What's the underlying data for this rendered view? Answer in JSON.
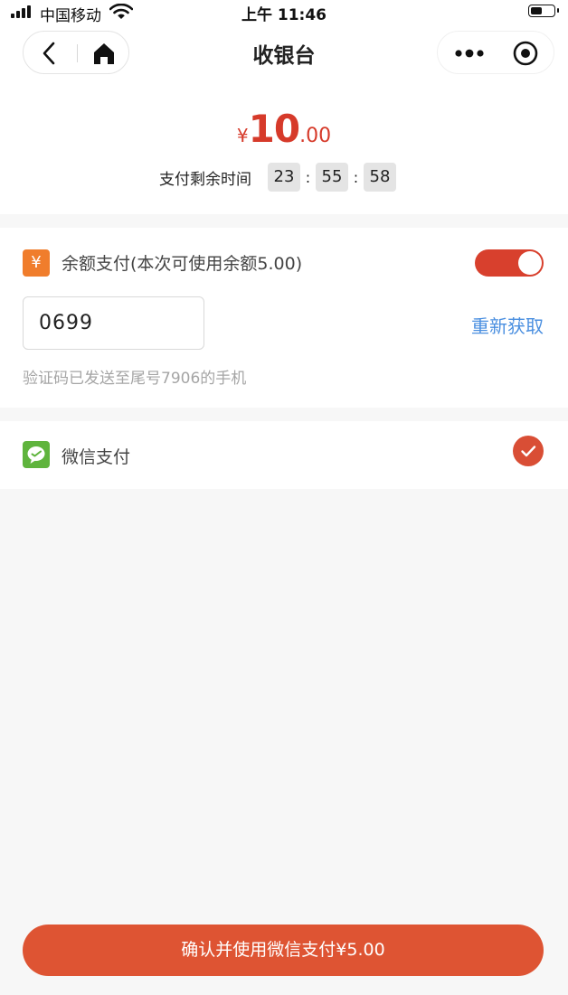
{
  "status_bar": {
    "carrier": "中国移动",
    "time": "上午 11:46",
    "battery_level": 0.55
  },
  "nav": {
    "title": "收银台",
    "icons": {
      "back": "chevron-left-icon",
      "home": "home-icon",
      "more": "more-dots-icon",
      "close": "target-close-icon"
    }
  },
  "amount": {
    "symbol": "¥",
    "integer": "10",
    "decimal": ".00",
    "color": "#d63a2a"
  },
  "countdown": {
    "label": "支付剩余时间",
    "hours": "23",
    "minutes": "55",
    "seconds": "58",
    "separator": ":"
  },
  "balance": {
    "badge": "¥",
    "label": "余额支付(本次可使用余额5.00)",
    "toggle_on": true,
    "code_value": "0699",
    "resend_label": "重新获取",
    "hint": "验证码已发送至尾号7906的手机",
    "accent": "#d8402d",
    "link_color": "#4a8fe0"
  },
  "wechat": {
    "label": "微信支付",
    "selected": true,
    "icon_color": "#5fb43d"
  },
  "confirm": {
    "label": "确认并使用微信支付¥5.00",
    "color": "#de5433"
  }
}
